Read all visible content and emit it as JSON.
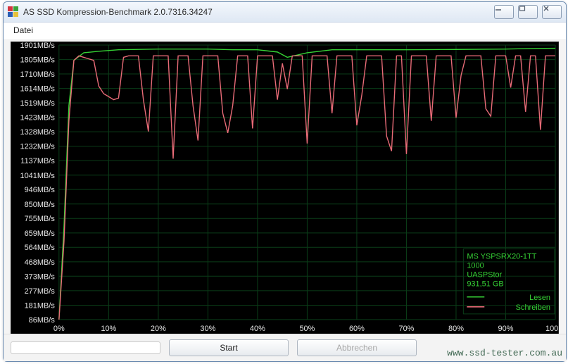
{
  "window": {
    "title": "AS SSD Kompression-Benchmark 2.0.7316.34247"
  },
  "menu": {
    "file": "Datei"
  },
  "buttons": {
    "start": "Start",
    "cancel": "Abbrechen"
  },
  "watermark": "www.ssd-tester.com.au",
  "legend": {
    "device": "MS YSPSRX20-1TT",
    "model_extra": "1000",
    "controller": "UASPStor",
    "capacity": "931,51 GB",
    "read": "Lesen",
    "write": "Schreiben"
  },
  "chart_data": {
    "type": "line",
    "xlabel": "",
    "ylabel": "",
    "x_ticks_pct": [
      0,
      10,
      20,
      30,
      40,
      50,
      60,
      70,
      80,
      90,
      100
    ],
    "y_ticks_mbs": [
      86,
      181,
      277,
      373,
      468,
      564,
      659,
      755,
      850,
      946,
      1041,
      1137,
      1232,
      1328,
      1423,
      1519,
      1614,
      1710,
      1805,
      1901
    ],
    "xlim": [
      0,
      100
    ],
    "ylim": [
      86,
      1901
    ],
    "y_unit": "MB/s",
    "series": [
      {
        "name": "Lesen",
        "color": "#35d135",
        "x": [
          0,
          1,
          2,
          3,
          5,
          8,
          12,
          20,
          30,
          35,
          40,
          44,
          46,
          50,
          55,
          60,
          70,
          80,
          90,
          95,
          100
        ],
        "y": [
          86,
          700,
          1500,
          1800,
          1850,
          1860,
          1870,
          1875,
          1875,
          1870,
          1870,
          1855,
          1820,
          1850,
          1870,
          1870,
          1870,
          1872,
          1875,
          1878,
          1880
        ]
      },
      {
        "name": "Schreiben",
        "color": "#e86b77",
        "x": [
          0,
          1,
          2,
          3,
          4,
          5,
          6,
          7,
          8,
          9,
          10,
          11,
          12,
          13,
          14,
          15,
          16,
          17,
          18,
          19,
          20,
          21,
          22,
          23,
          24,
          25,
          26,
          27,
          28,
          29,
          30,
          31,
          32,
          33,
          34,
          35,
          36,
          37,
          38,
          39,
          40,
          41,
          42,
          43,
          44,
          45,
          46,
          47,
          48,
          49,
          50,
          51,
          52,
          53,
          54,
          55,
          56,
          57,
          58,
          59,
          60,
          61,
          62,
          63,
          64,
          65,
          66,
          67,
          68,
          69,
          70,
          71,
          72,
          73,
          74,
          75,
          76,
          77,
          78,
          79,
          80,
          81,
          82,
          83,
          84,
          85,
          86,
          87,
          88,
          89,
          90,
          91,
          92,
          93,
          94,
          95,
          96,
          97,
          98,
          99,
          100
        ],
        "y": [
          86,
          600,
          1400,
          1800,
          1830,
          1820,
          1810,
          1800,
          1630,
          1580,
          1560,
          1540,
          1550,
          1820,
          1830,
          1830,
          1830,
          1540,
          1330,
          1830,
          1830,
          1830,
          1830,
          1150,
          1830,
          1830,
          1830,
          1500,
          1270,
          1830,
          1830,
          1830,
          1830,
          1450,
          1320,
          1500,
          1830,
          1830,
          1830,
          1350,
          1830,
          1830,
          1830,
          1830,
          1540,
          1780,
          1610,
          1830,
          1830,
          1830,
          1250,
          1830,
          1830,
          1830,
          1830,
          1450,
          1830,
          1830,
          1830,
          1830,
          1370,
          1570,
          1830,
          1830,
          1830,
          1830,
          1300,
          1200,
          1830,
          1830,
          1180,
          1830,
          1830,
          1830,
          1830,
          1400,
          1830,
          1830,
          1830,
          1830,
          1420,
          1700,
          1830,
          1830,
          1830,
          1830,
          1480,
          1430,
          1830,
          1830,
          1830,
          1620,
          1830,
          1830,
          1460,
          1830,
          1830,
          1340,
          1830,
          1830,
          1830
        ]
      }
    ]
  }
}
